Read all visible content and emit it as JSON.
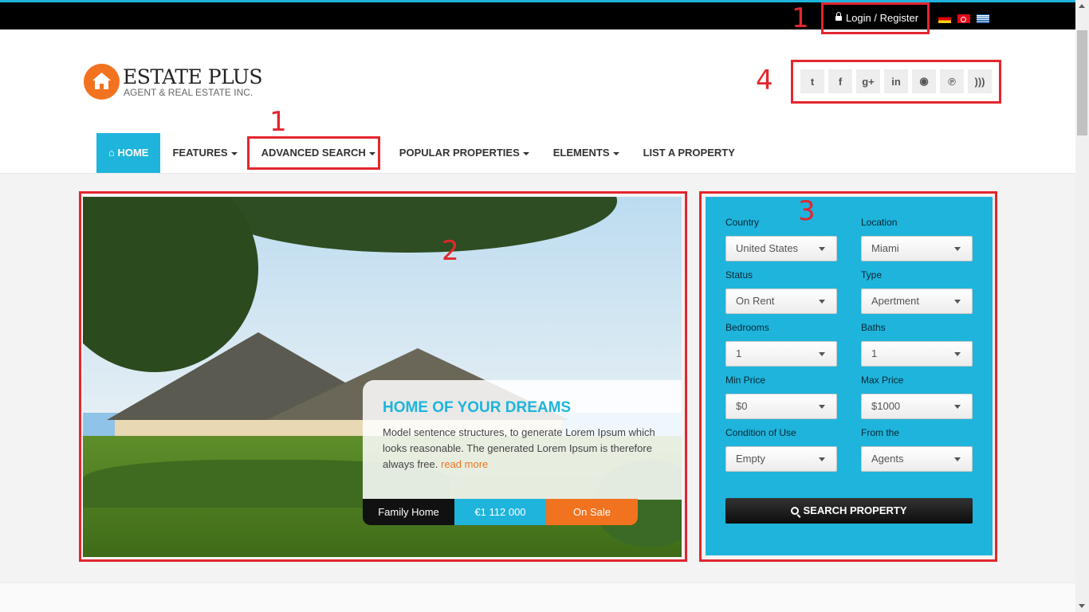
{
  "topbar": {
    "login_label": "Login / Register",
    "languages": [
      "german-flag",
      "turkish-flag",
      "greek-flag"
    ]
  },
  "brand": {
    "name": "ESTATE PLUS",
    "subtitle": "AGENT & REAL ESTATE INC.",
    "logo_icon": "home-icon",
    "accent_color": "#f1731f"
  },
  "social": [
    "twitter-icon",
    "facebook-icon",
    "google-plus-icon",
    "linkedin-icon",
    "github-icon",
    "pinterest-icon",
    "rss-icon"
  ],
  "nav": {
    "home": "HOME",
    "features": "FEATURES",
    "advanced_search": "ADVANCED SEARCH",
    "popular_properties": "POPULAR PROPERTIES",
    "elements": "ELEMENTS",
    "list_property": "LIST A PROPERTY",
    "active_color": "#1eb4dc"
  },
  "hero": {
    "title": "HOME OF YOUR DREAMS",
    "text": "Model sentence structures, to generate Lorem Ipsum which looks reasonable. The generated Lorem Ipsum is therefore always free.",
    "read_more": "read more",
    "tag_type": "Family Home",
    "tag_price": "€1 112 000",
    "tag_status": "On Sale"
  },
  "search": {
    "country_label": "Country",
    "country_value": "United States",
    "location_label": "Location",
    "location_value": "Miami",
    "status_label": "Status",
    "status_value": "On Rent",
    "type_label": "Type",
    "type_value": "Apertment",
    "bedrooms_label": "Bedrooms",
    "bedrooms_value": "1",
    "baths_label": "Baths",
    "baths_value": "1",
    "min_price_label": "Min Price",
    "min_price_value": "$0",
    "max_price_label": "Max Price",
    "max_price_value": "$1000",
    "condition_label": "Condition of Use",
    "condition_value": "Empty",
    "from_label": "From the",
    "from_value": "Agents",
    "button_label": "SEARCH PROPERTY"
  },
  "annotations": {
    "n1": "1",
    "n1b": "1",
    "n2": "2",
    "n3": "3",
    "n4": "4",
    "color": "#e3262e"
  }
}
